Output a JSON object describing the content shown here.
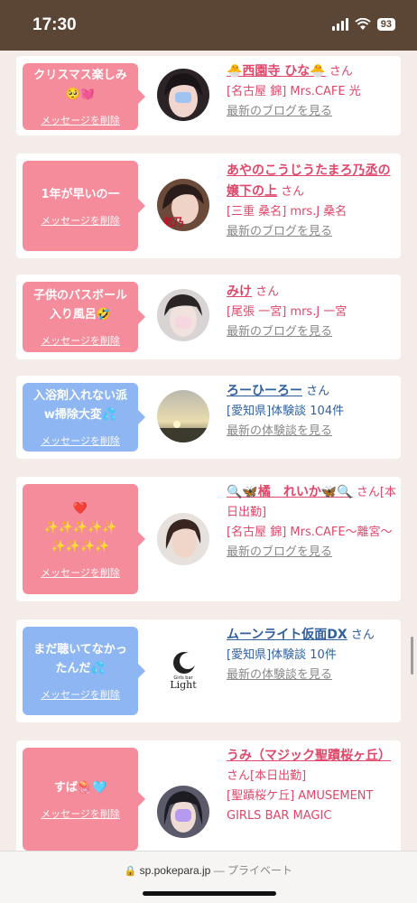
{
  "status": {
    "time": "17:30",
    "battery": "93"
  },
  "cards": [
    {
      "bubble_color": "pink",
      "message": "クリスマス楽しみ\n🥺💓",
      "delete_label": "メッセージを削除",
      "name": "🐣西園寺 ひな🐣",
      "san": "さん",
      "meta": "[名古屋 錦] Mrs.CAFE 光",
      "more": "最新のブログを見る",
      "tone": "pink",
      "avatar": "avatar-girl-1"
    },
    {
      "bubble_color": "pink",
      "message": "1年が早いの一",
      "delete_label": "メッセージを削除",
      "name": "あやのこうじうたまろ乃丞の嬢下の上",
      "san": "さん",
      "meta": "[三重 桑名] mrs.J 桑名",
      "more": "最新のブログを見る",
      "tone": "pink",
      "avatar": "avatar-girl-2"
    },
    {
      "bubble_color": "pink",
      "message": "子供のバスボール\n入り風呂🤣",
      "delete_label": "メッセージを削除",
      "name": "みけ",
      "san": "さん",
      "meta": "[尾張 一宮] mrs.J 一宮",
      "more": "最新のブログを見る",
      "tone": "pink",
      "avatar": "avatar-girl-3"
    },
    {
      "bubble_color": "blue",
      "message": "入浴剤入れない派\nw掃除大変💦",
      "delete_label": "メッセージを削除",
      "name": "ろーひーろー",
      "san": "さん",
      "meta": "[愛知県]体験談 104件",
      "more": "最新の体験談を見る",
      "tone": "blue",
      "avatar": "avatar-sunset"
    },
    {
      "bubble_color": "pink",
      "message": "❤️\n✨✨✨✨✨\n✨✨✨✨",
      "delete_label": "メッセージを削除",
      "name": "🔍🦋橘　れいか🦋🔍",
      "san": "さん",
      "meta_prefix": "[本日出勤]",
      "meta": "[名古屋 錦] Mrs.CAFE〜離宮〜",
      "more": "最新のブログを見る",
      "tone": "pink",
      "avatar": "avatar-girl-4"
    },
    {
      "bubble_color": "blue",
      "message": "まだ聴いてなかっ\nたんだ💦",
      "delete_label": "メッセージを削除",
      "name": "ムーンライト仮面DX",
      "san": "さん",
      "meta": "[愛知県]体験談 10件",
      "more": "最新の体験談を見る",
      "tone": "blue",
      "avatar": "avatar-logo-light",
      "avatar_logo_small": "Girls bar",
      "avatar_logo_text": "Light"
    },
    {
      "bubble_color": "pink",
      "message": "すば🪼🩵",
      "delete_label": "メッセージを削除",
      "name": "うみ（マジック聖蹟桜ヶ丘）",
      "san": "さん",
      "meta_prefix": "[本日出勤]",
      "meta": "[聖蹟桜ケ丘] AMUSEMENT GIRLS BAR MAGIC",
      "more": "",
      "tone": "pink",
      "avatar": "avatar-girl-5"
    }
  ],
  "url_bar": {
    "domain": "sp.pokepara.jp",
    "separator": "—",
    "mode": "プライベート"
  }
}
